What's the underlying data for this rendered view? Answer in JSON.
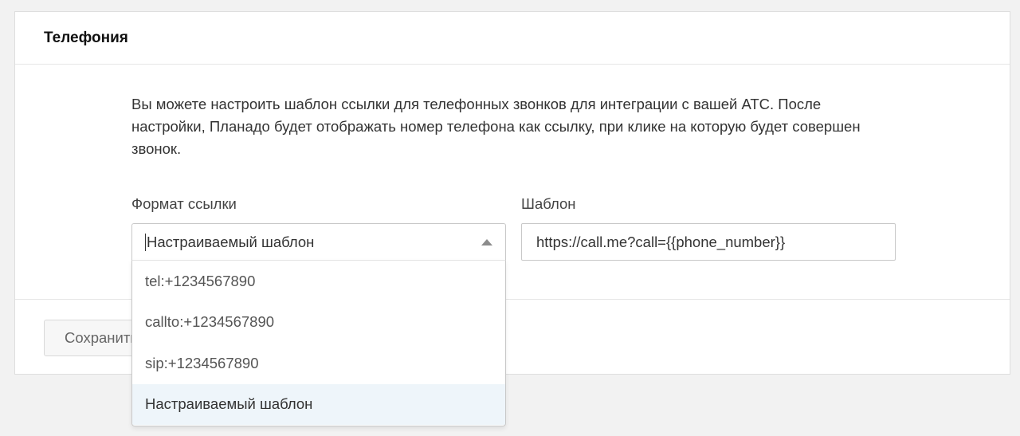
{
  "card": {
    "title": "Телефония",
    "description": "Вы можете настроить шаблон ссылки для телефонных звонков для интеграции с вашей АТС. После настройки, Планадо будет отображать номер телефона как ссылку, при клике на которую будет совершен звонок."
  },
  "link_format": {
    "label": "Формат ссылки",
    "selected_value": "Настраиваемый шаблон",
    "options": [
      "tel:+1234567890",
      "callto:+1234567890",
      "sip:+1234567890",
      "Настраиваемый шаблон"
    ],
    "selected_index": 3
  },
  "template": {
    "label": "Шаблон",
    "value": "https://call.me?call={{phone_number}}"
  },
  "footer": {
    "save_label": "Сохранить"
  },
  "colors": {
    "selected_option_bg": "#eef5fa"
  }
}
